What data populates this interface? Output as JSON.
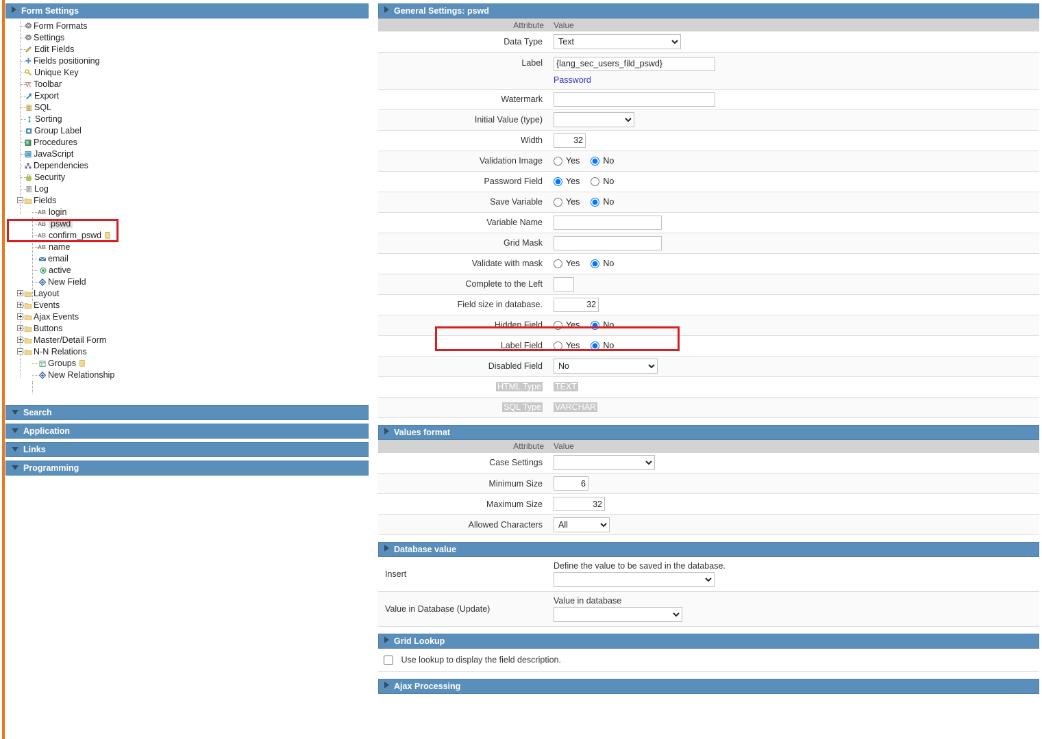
{
  "sidebar": {
    "form_settings": {
      "title": "Form Settings",
      "items": [
        {
          "label": "Form Formats",
          "icon": "gear-icon"
        },
        {
          "label": "Settings",
          "icon": "gear-icon"
        },
        {
          "label": "Edit Fields",
          "icon": "pencil-icon"
        },
        {
          "label": "Fields positioning",
          "icon": "move-cross-icon"
        },
        {
          "label": "Unique Key",
          "icon": "key-icon"
        },
        {
          "label": "Toolbar",
          "icon": "toolbar-icon"
        },
        {
          "label": "Export",
          "icon": "export-arrow-icon"
        },
        {
          "label": "SQL",
          "icon": "sql-lines-icon"
        },
        {
          "label": "Sorting",
          "icon": "sort-updown-icon"
        },
        {
          "label": "Group Label",
          "icon": "group-label-icon"
        },
        {
          "label": "Procedures",
          "icon": "procedures-icon"
        },
        {
          "label": "JavaScript",
          "icon": "javascript-icon"
        },
        {
          "label": "Dependencies",
          "icon": "dependencies-icon"
        },
        {
          "label": "Security",
          "icon": "lock-icon"
        },
        {
          "label": "Log",
          "icon": "log-icon"
        }
      ],
      "fields_folder": {
        "label": "Fields",
        "icon": "folder-icon",
        "state": "expanded"
      },
      "fields": [
        {
          "label": "login",
          "icon": "ab-text-icon",
          "selected": false,
          "tag": ""
        },
        {
          "label": "pswd",
          "icon": "ab-text-icon",
          "selected": true,
          "tag": ""
        },
        {
          "label": "confirm_pswd",
          "icon": "ab-text-icon",
          "selected": false,
          "tag": "note-icon"
        },
        {
          "label": "name",
          "icon": "ab-text-icon",
          "selected": false,
          "tag": ""
        },
        {
          "label": "email",
          "icon": "email-icon",
          "selected": false,
          "tag": ""
        },
        {
          "label": "active",
          "icon": "radio-green-icon",
          "selected": false,
          "tag": ""
        },
        {
          "label": "New Field",
          "icon": "new-diamond-icon",
          "selected": false,
          "tag": ""
        }
      ],
      "folders": [
        {
          "label": "Layout",
          "state": "collapsed"
        },
        {
          "label": "Events",
          "state": "collapsed"
        },
        {
          "label": "Ajax Events",
          "state": "collapsed"
        },
        {
          "label": "Buttons",
          "state": "collapsed"
        },
        {
          "label": "Master/Detail Form",
          "state": "collapsed"
        },
        {
          "label": "N-N Relations",
          "state": "expanded"
        }
      ],
      "nn_children": [
        {
          "label": "Groups",
          "icon": "grid-icon",
          "tag": "note-icon"
        },
        {
          "label": "New Relationship",
          "icon": "new-diamond-icon",
          "tag": ""
        }
      ]
    },
    "collapsed_panels": [
      {
        "label": "Search",
        "state": "down"
      },
      {
        "label": "Application",
        "state": "down"
      },
      {
        "label": "Links",
        "state": "down"
      },
      {
        "label": "Programming",
        "state": "down"
      }
    ]
  },
  "main": {
    "general": {
      "title": "General Settings: pswd",
      "col_attribute": "Attribute",
      "col_value": "Value",
      "rows": {
        "data_type": {
          "label": "Data Type",
          "value": "Text"
        },
        "label": {
          "label": "Label",
          "value": "{lang_sec_users_fild_pswd}",
          "link": "Password"
        },
        "watermark": {
          "label": "Watermark",
          "value": ""
        },
        "initial_value": {
          "label": "Initial Value (type)",
          "value": ""
        },
        "width": {
          "label": "Width",
          "value": "32"
        },
        "validation_image": {
          "label": "Validation Image",
          "yes": "Yes",
          "no": "No",
          "selected": "No"
        },
        "password_field": {
          "label": "Password Field",
          "yes": "Yes",
          "no": "No",
          "selected": "Yes"
        },
        "save_variable": {
          "label": "Save Variable",
          "yes": "Yes",
          "no": "No",
          "selected": "No"
        },
        "variable_name": {
          "label": "Variable Name",
          "value": ""
        },
        "grid_mask": {
          "label": "Grid Mask",
          "value": ""
        },
        "validate_with_mask": {
          "label": "Validate with mask",
          "yes": "Yes",
          "no": "No",
          "selected": "No"
        },
        "complete_left": {
          "label": "Complete to the Left",
          "value": ""
        },
        "field_size_db": {
          "label": "Field size in database.",
          "value": "32"
        },
        "hidden_field": {
          "label": "Hidden Field",
          "yes": "Yes",
          "no": "No",
          "selected": "No",
          "highlighted": true
        },
        "label_field": {
          "label": "Label Field",
          "yes": "Yes",
          "no": "No",
          "selected": "No"
        },
        "disabled_field": {
          "label": "Disabled Field",
          "value": "No"
        },
        "html_type": {
          "label": "HTML Type",
          "value": "TEXT"
        },
        "sql_type": {
          "label": "SQL Type",
          "value": "VARCHAR"
        }
      }
    },
    "values_format": {
      "title": "Values format",
      "col_attribute": "Attribute",
      "col_value": "Value",
      "rows": {
        "case_settings": {
          "label": "Case Settings",
          "value": ""
        },
        "minimum_size": {
          "label": "Minimum Size",
          "value": "6"
        },
        "maximum_size": {
          "label": "Maximum Size",
          "value": "32"
        },
        "allowed_characters": {
          "label": "Allowed Characters",
          "value": "All"
        }
      }
    },
    "database_value": {
      "title": "Database value",
      "rows": {
        "insert": {
          "label": "Insert",
          "hint": "Define the value to be saved in the database.",
          "value": ""
        },
        "update": {
          "label": "Value in Database (Update)",
          "hint": "Value in database",
          "value": ""
        }
      }
    },
    "grid_lookup": {
      "title": "Grid Lookup",
      "checkbox_label": "Use lookup to display the field description.",
      "checked": false
    },
    "ajax_processing": {
      "title": "Ajax Processing"
    }
  },
  "colors": {
    "panel_header": "#5b8fbb",
    "panel_header_border": "#4d7fa8",
    "accent_orange": "#e8781a",
    "highlight_red": "#d81e1e",
    "table_header": "#d3d3d3",
    "link_blue": "#3333cc"
  }
}
